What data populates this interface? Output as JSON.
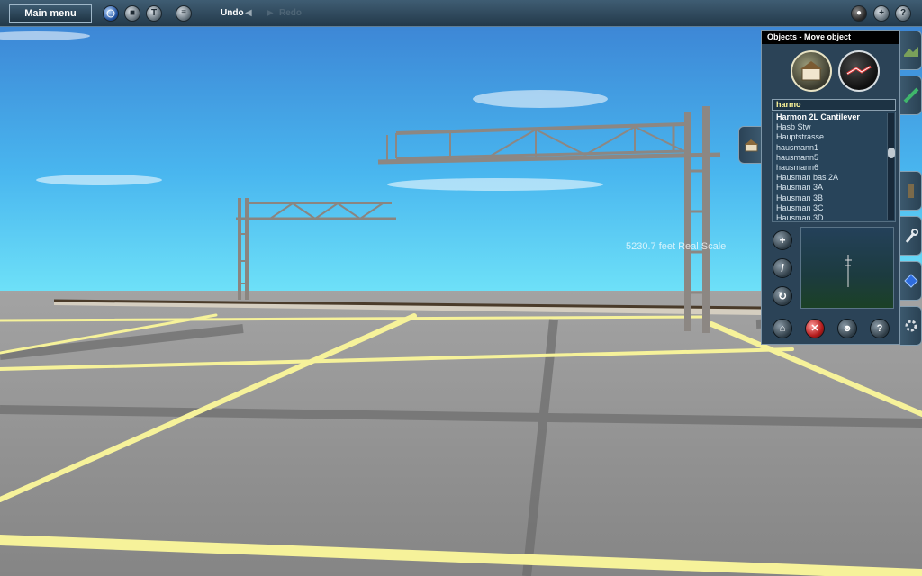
{
  "toolbar": {
    "main_menu_label": "Main menu",
    "undo_label": "Undo",
    "redo_label": "Redo",
    "left_icons": [
      "globe-icon",
      "stop-icon",
      "tool-icon",
      "layers-icon"
    ],
    "right_icons": [
      "view-icon",
      "add-icon",
      "help-icon"
    ]
  },
  "viewport": {
    "scale_readout": "5230.7 feet   Real Scale"
  },
  "objects_panel": {
    "title": "Objects - Move object",
    "search_value": "harmo",
    "items": [
      "Harmon 2L Cantilever",
      "Hasb Stw",
      "Hauptstrasse",
      "hausmann1",
      "hausmann5",
      "hausmann6",
      "Hausman bas 2A",
      "Hausman 3A",
      "Hausman 3B",
      "Hausman 3C",
      "Hausman 3D"
    ],
    "selected_index": 0,
    "side_tools": [
      "plus-icon",
      "wrench-icon",
      "rotate-icon"
    ],
    "bottom_tools": [
      "home-icon",
      "delete-icon",
      "person-icon",
      "help-icon"
    ]
  },
  "tabs": [
    "terrain-tab",
    "track-tab",
    "rail-tab",
    "tools-tab",
    "gem-tab",
    "settings-tab"
  ],
  "colors": {
    "accent": "#2b4357",
    "selection": "#fff79a",
    "sky_top": "#3e8edc",
    "sky_bottom": "#5ed8f6",
    "ground": "#8a8a8a",
    "grid_line": "#f6f29a"
  }
}
